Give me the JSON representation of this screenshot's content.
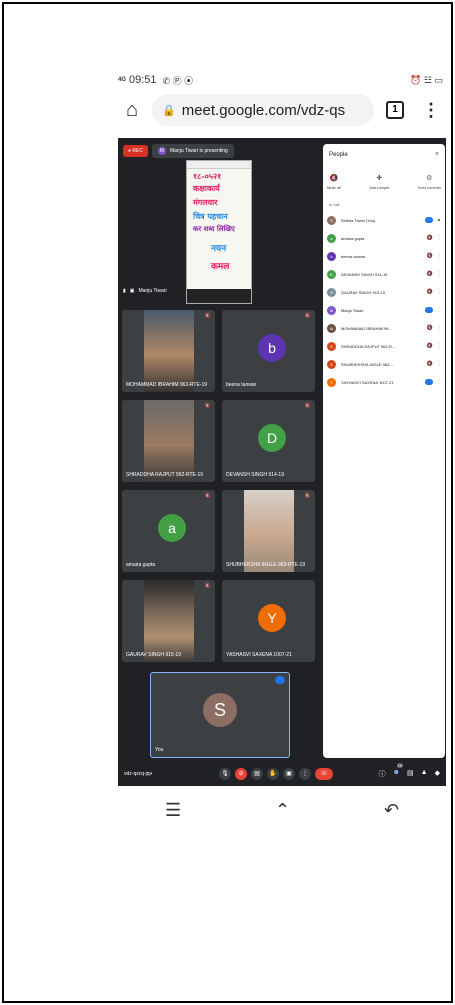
{
  "status": {
    "network": "4G",
    "time": "09:51",
    "left_icons": "✆ Ⓟ ⦿",
    "right_icons": "⏰ ☳ ▭"
  },
  "browser": {
    "url": "meet.google.com/vdz-qs",
    "tab_count": "1"
  },
  "meet": {
    "rec_label": "REC",
    "presenting_text": "Manju Tiwari is presenting",
    "presenter_initial": "M",
    "pinned_name": "Manju Tiwari",
    "screen_lines": [
      "१८-०५२१",
      "कक्षाकार्य",
      "मंगलवार",
      "चित्र पहचान",
      "कर शब्द लिखिए",
      "नयन",
      "कमल"
    ],
    "tiles": [
      {
        "name": "MOHAMMAD IBRAHIM 963-RTE-19",
        "initial": "",
        "color": ""
      },
      {
        "name": "beena tanwar",
        "initial": "b",
        "color": "#5e35b1"
      },
      {
        "name": "SHRADDHA RAJPUT 962-RTE-19",
        "initial": "",
        "color": ""
      },
      {
        "name": "DEVANSH SINGH 914-19",
        "initial": "D",
        "color": "#43a047"
      },
      {
        "name": "amaira gupta",
        "initial": "a",
        "color": "#43a047"
      },
      {
        "name": "SHUBHEKSHA INGLE 963-RTE-19",
        "initial": "",
        "color": ""
      },
      {
        "name": "GAURAV SINGH 915-19",
        "initial": "",
        "color": ""
      },
      {
        "name": "YASHASVI SAXENA 1007-21",
        "initial": "Y",
        "color": "#ef6c00"
      }
    ],
    "you": {
      "initial": "S",
      "label": "You"
    },
    "people_panel": {
      "title": "People",
      "close": "×",
      "actions": [
        "Mute all",
        "Add people",
        "Host controls"
      ],
      "in_call_label": "In call",
      "participants": [
        {
          "name": "Shikha Tiwari (You)",
          "initial": "S",
          "color": "#8d6e63"
        },
        {
          "name": "amaira gupta",
          "initial": "a",
          "color": "#43a047"
        },
        {
          "name": "beena tanwar",
          "initial": "b",
          "color": "#5e35b1"
        },
        {
          "name": "DEVANSH SINGH 914-19",
          "initial": "D",
          "color": "#43a047"
        },
        {
          "name": "GAURAV SINGH 915-19",
          "initial": "G",
          "color": "#78909c"
        },
        {
          "name": "Manju Tiwari",
          "initial": "M",
          "color": "#7b55c7"
        },
        {
          "name": "MOHAMMAD IBRAHIM 96...",
          "initial": "M",
          "color": "#6d4c41"
        },
        {
          "name": "SHRADDHA RAJPUT 962-R...",
          "initial": "S",
          "color": "#d84315"
        },
        {
          "name": "SHUBHEKSHA INGLE 963-...",
          "initial": "S",
          "color": "#d84315"
        },
        {
          "name": "YASHASVI SAXENA 1007-21",
          "initial": "Y",
          "color": "#ef6c00"
        }
      ]
    },
    "meeting_code": "vdz-qscq-jqv",
    "people_count": "10"
  }
}
